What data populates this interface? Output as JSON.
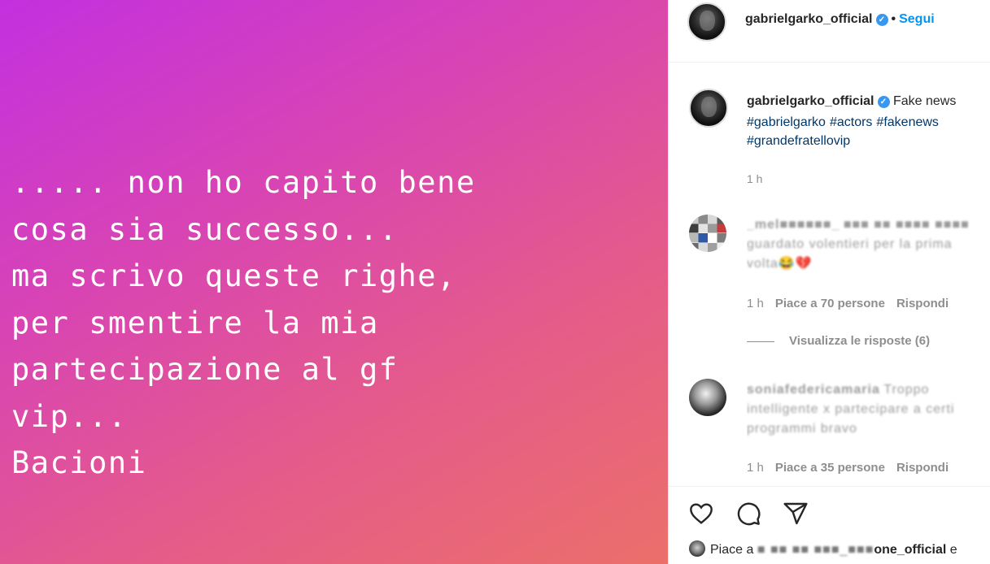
{
  "story": {
    "lines": [
      "..... non ho capito bene",
      "cosa sia successo...",
      "ma scrivo queste righe,",
      "per smentire la mia",
      "partecipazione al gf",
      "vip...",
      "Bacioni"
    ]
  },
  "header": {
    "username": "gabrielgarko_official",
    "separator": "•",
    "follow_label": "Segui"
  },
  "caption": {
    "username": "gabrielgarko_official",
    "text": "Fake news",
    "hashtags": [
      "#gabrielgarko",
      "#actors",
      "#fakenews",
      "#grandefratellovip"
    ],
    "time": "1 h"
  },
  "comments": [
    {
      "username": "_mel■■■■■■_",
      "text_line1": "■■■ ■■ ■■■■ ■■■■",
      "text_line2": "guardato volentieri per la prima",
      "text_line3": "volta😂💔",
      "time": "1 h",
      "likes": "Piace a 70 persone",
      "reply": "Rispondi",
      "view_replies": "Visualizza le risposte (6)"
    },
    {
      "username": "soniafedericamaria",
      "text_line1": "Troppo",
      "text_line2": "intelligente x partecipare a certi",
      "text_line3": "programmi bravo",
      "time": "1 h",
      "likes": "Piace a 35 persone",
      "reply": "Rispondi"
    }
  ],
  "likes_bar": {
    "prefix": "Piace a",
    "blurred_name": "■ ■■ ■■ ■■■_■■■",
    "visible_name": "one_official",
    "suffix": "e"
  },
  "icons": [
    "heart-icon",
    "comment-icon",
    "share-icon",
    "verified-icon"
  ],
  "colors": {
    "link": "#0095f6",
    "hashtag": "#00376b",
    "verified": "#3897f0",
    "muted": "#8e8e8e"
  }
}
